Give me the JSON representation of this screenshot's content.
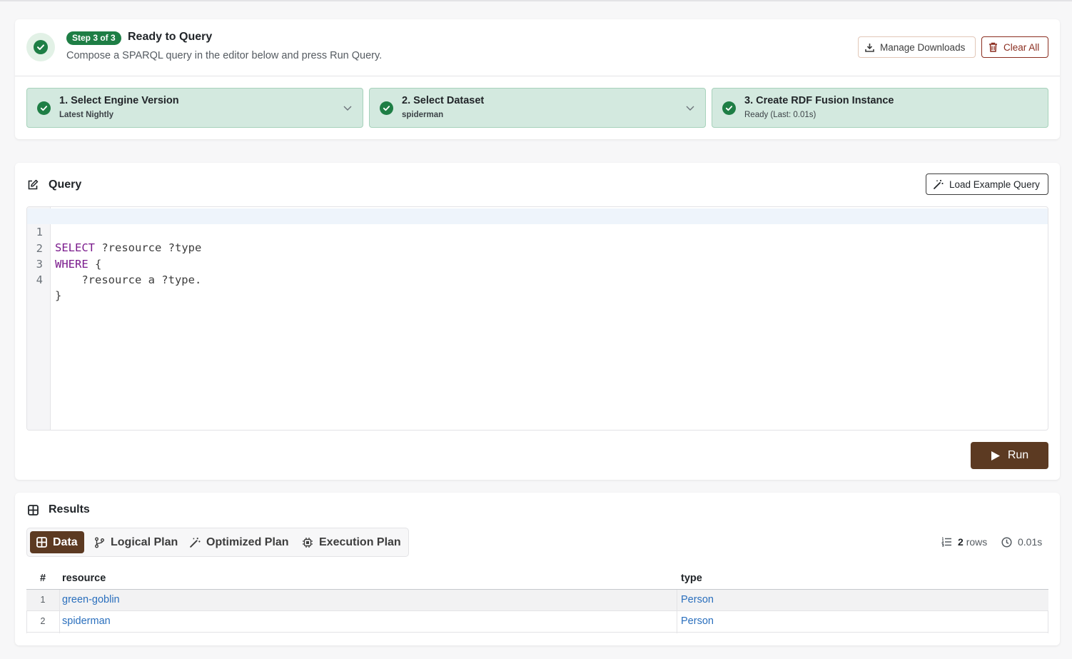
{
  "status": {
    "step_badge": "Step 3 of 3",
    "title": "Ready to Query",
    "subtitle": "Compose a SPARQL query in the editor below and press Run Query.",
    "manage_downloads_label": "Manage Downloads",
    "clear_all_label": "Clear All"
  },
  "steps": [
    {
      "title": "1. Select Engine Version",
      "subtitle": "Latest Nightly"
    },
    {
      "title": "2. Select Dataset",
      "subtitle": "spiderman"
    },
    {
      "title": "3. Create RDF Fusion Instance",
      "subtitle": "Ready (Last: 0.01s)"
    }
  ],
  "query": {
    "title": "Query",
    "load_example_label": "Load Example Query",
    "run_label": "Run",
    "lines": [
      {
        "num": "1",
        "keyword": "SELECT",
        "rest": " ?resource ?type"
      },
      {
        "num": "2",
        "keyword": "WHERE",
        "rest": " {"
      },
      {
        "num": "3",
        "keyword": "",
        "rest": "    ?resource a ?type."
      },
      {
        "num": "4",
        "keyword": "",
        "rest": "}"
      }
    ]
  },
  "results": {
    "title": "Results",
    "tabs": [
      "Data",
      "Logical Plan",
      "Optimized Plan",
      "Execution Plan"
    ],
    "active_tab": "Data",
    "row_count": "2",
    "rows_label": "rows",
    "duration": "0.01s",
    "columns": [
      "#",
      "resource",
      "type"
    ],
    "rows": [
      {
        "num": "1",
        "resource": "green-goblin",
        "type": "Person"
      },
      {
        "num": "2",
        "resource": "spiderman",
        "type": "Person"
      }
    ]
  },
  "colors": {
    "success": "#1e7e45",
    "step_bg": "#d3e9df",
    "brand_brown": "#5c3a22",
    "danger": "#8b2e20",
    "link": "#2a6fbd",
    "keyword": "#7a1a8c"
  }
}
